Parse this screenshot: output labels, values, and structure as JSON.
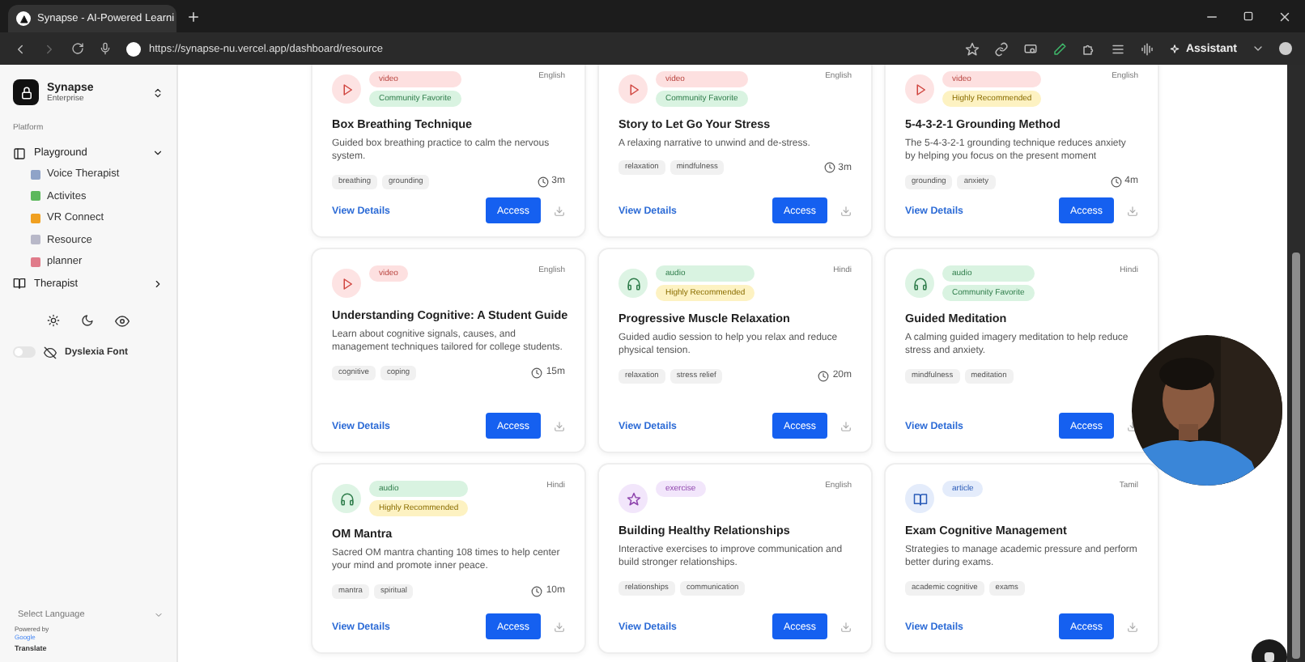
{
  "browser": {
    "tab_title": "Synapse - AI-Powered Learni",
    "url": "https://synapse-nu.vercel.app/dashboard/resource",
    "assistant": "Assistant"
  },
  "sidebar": {
    "brand": {
      "name": "Synapse",
      "plan": "Enterprise"
    },
    "section_label": "Platform",
    "items": [
      {
        "label": "Playground",
        "expanded": true,
        "children": [
          {
            "label": "Voice Therapist"
          },
          {
            "label": "Activites"
          },
          {
            "label": "VR Connect"
          },
          {
            "label": "Resource"
          },
          {
            "label": "planner"
          }
        ]
      },
      {
        "label": "Therapist",
        "expanded": false
      }
    ],
    "dyslexia_toggle": {
      "label": "Dyslexia Font",
      "on": false
    },
    "language": {
      "placeholder": "Select Language",
      "powered_by": "Powered by",
      "google": "Google",
      "translate": "Translate"
    }
  },
  "cards": [
    {
      "kind": "video",
      "badges": [
        {
          "text": "video",
          "kind": "video"
        },
        {
          "text": "Community Favorite",
          "kind": "favorite"
        }
      ],
      "language": "English",
      "title": "Box Breathing Technique",
      "description": "Guided box breathing practice to calm the nervous system.",
      "tags": [
        "breathing",
        "grounding"
      ],
      "duration": "3m",
      "details": "View Details",
      "access": "Access"
    },
    {
      "kind": "video",
      "badges": [
        {
          "text": "video",
          "kind": "video"
        },
        {
          "text": "Community Favorite",
          "kind": "favorite"
        }
      ],
      "language": "English",
      "title": "Story to Let Go Your Stress",
      "description": "A relaxing narrative to unwind and de-stress.",
      "tags": [
        "relaxation",
        "mindfulness"
      ],
      "duration": "3m",
      "details": "View Details",
      "access": "Access"
    },
    {
      "kind": "video",
      "badges": [
        {
          "text": "video",
          "kind": "video"
        },
        {
          "text": "Highly Recommended",
          "kind": "recommended"
        }
      ],
      "language": "English",
      "title": "5-4-3-2-1 Grounding Method",
      "description": "The 5-4-3-2-1 grounding technique reduces anxiety by helping you focus on the present moment",
      "tags": [
        "grounding",
        "anxiety"
      ],
      "duration": "4m",
      "details": "View Details",
      "access": "Access"
    },
    {
      "kind": "video",
      "badges": [
        {
          "text": "video",
          "kind": "video"
        }
      ],
      "language": "English",
      "title": "Understanding Cognitive: A Student Guide",
      "description": "Learn about cognitive signals, causes, and management techniques tailored for college students.",
      "tags": [
        "cognitive",
        "coping"
      ],
      "duration": "15m",
      "details": "View Details",
      "access": "Access"
    },
    {
      "kind": "audio",
      "badges": [
        {
          "text": "audio",
          "kind": "audio"
        },
        {
          "text": "Highly Recommended",
          "kind": "recommended"
        }
      ],
      "language": "Hindi",
      "title": "Progressive Muscle Relaxation",
      "description": "Guided audio session to help you relax and reduce physical tension.",
      "tags": [
        "relaxation",
        "stress relief"
      ],
      "duration": "20m",
      "details": "View Details",
      "access": "Access"
    },
    {
      "kind": "audio",
      "badges": [
        {
          "text": "audio",
          "kind": "audio"
        },
        {
          "text": "Community Favorite",
          "kind": "favorite"
        }
      ],
      "language": "Hindi",
      "title": "Guided Meditation",
      "description": "A calming guided imagery meditation to help reduce stress and anxiety.",
      "tags": [
        "mindfulness",
        "meditation"
      ],
      "details": "View Details",
      "access": "Access"
    },
    {
      "kind": "audio",
      "badges": [
        {
          "text": "audio",
          "kind": "audio"
        },
        {
          "text": "Highly Recommended",
          "kind": "recommended"
        }
      ],
      "language": "Hindi",
      "title": "OM Mantra",
      "description": "Sacred OM mantra chanting 108 times to help center your mind and promote inner peace.",
      "tags": [
        "mantra",
        "spiritual"
      ],
      "duration": "10m",
      "details": "View Details",
      "access": "Access"
    },
    {
      "kind": "exercise",
      "badges": [
        {
          "text": "exercise",
          "kind": "exercise"
        }
      ],
      "language": "English",
      "title": "Building Healthy Relationships",
      "description": "Interactive exercises to improve communication and build stronger relationships.",
      "tags": [
        "relationships",
        "communication"
      ],
      "details": "View Details",
      "access": "Access"
    },
    {
      "kind": "article",
      "badges": [
        {
          "text": "article",
          "kind": "article"
        }
      ],
      "language": "Tamil",
      "title": "Exam Cognitive Management",
      "description": "Strategies to manage academic pressure and perform better during exams.",
      "tags": [
        "academic cognitive",
        "exams"
      ],
      "details": "View Details",
      "access": "Access"
    }
  ]
}
